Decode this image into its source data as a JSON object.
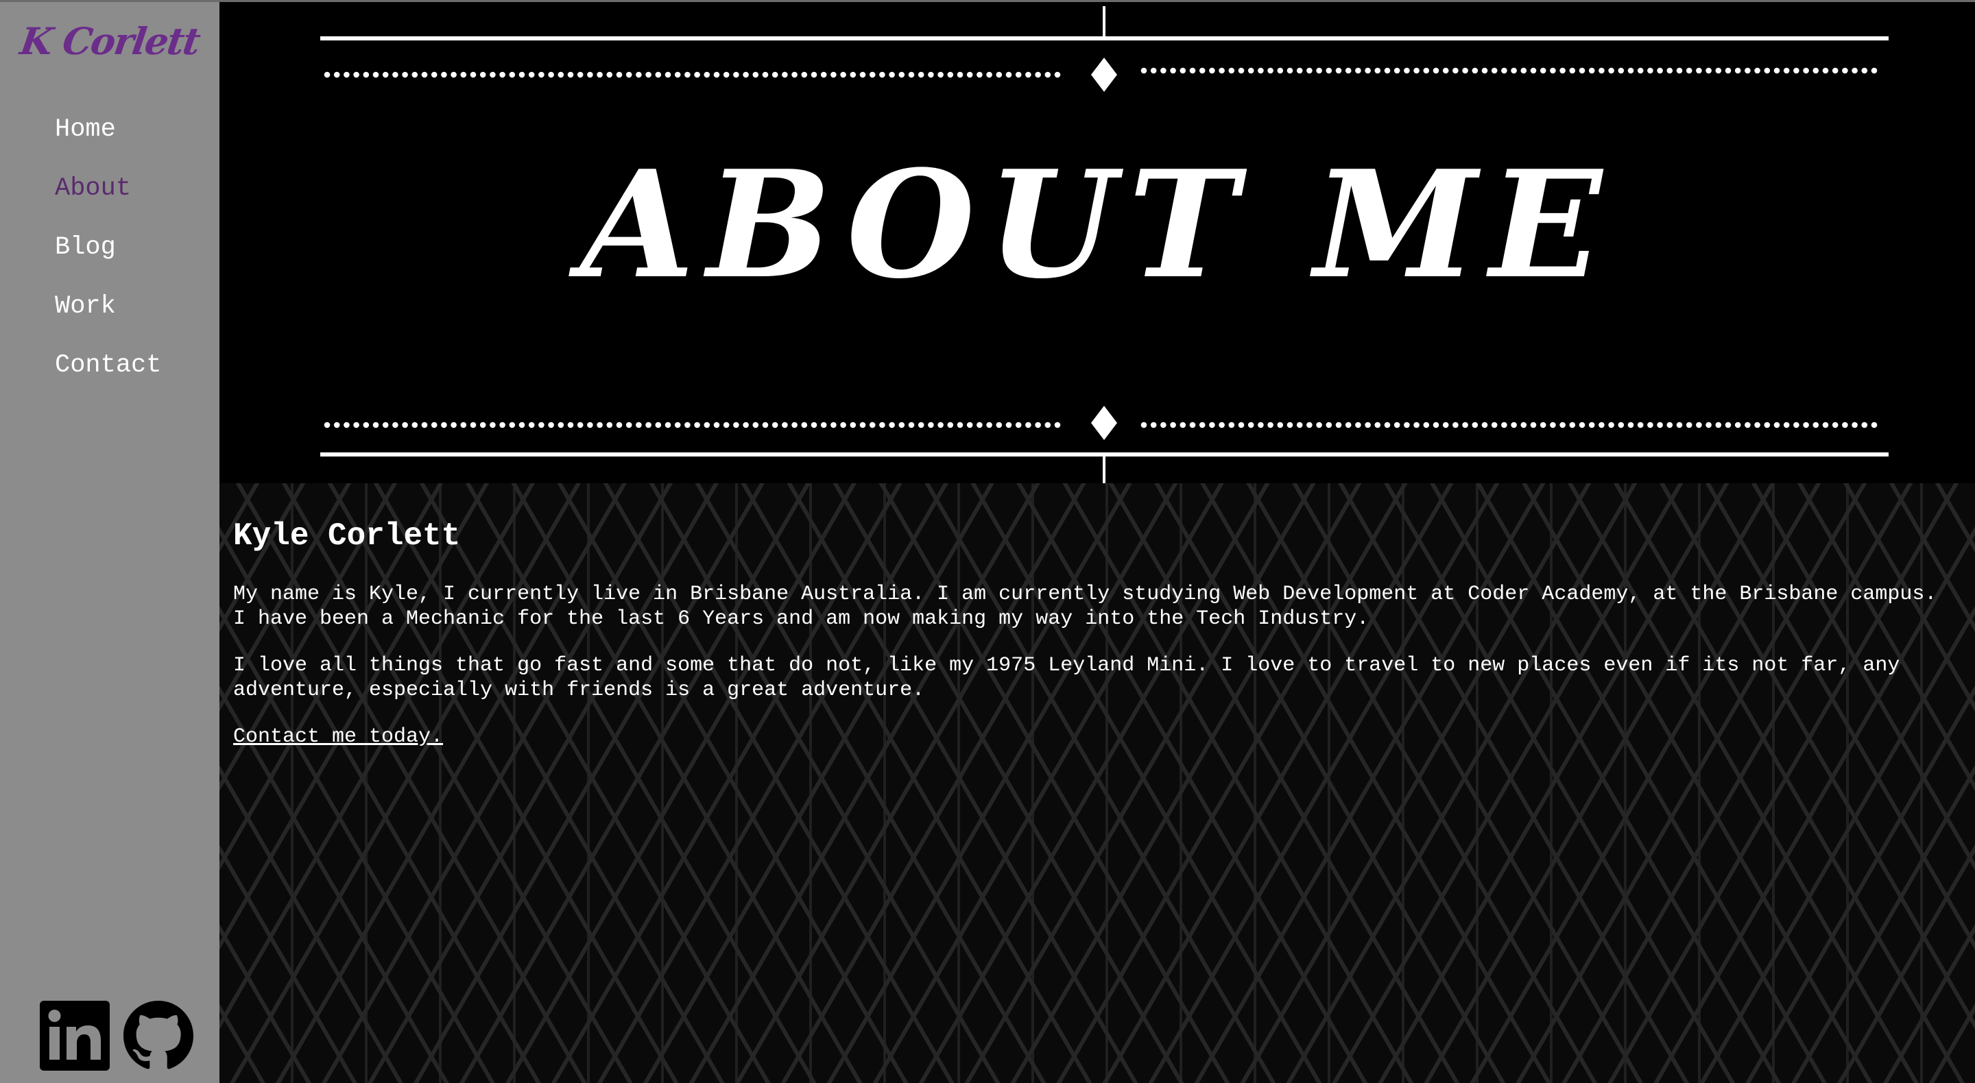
{
  "sidebar": {
    "logo": "K Corlett",
    "nav": [
      {
        "label": "Home"
      },
      {
        "label": "About"
      },
      {
        "label": "Blog"
      },
      {
        "label": "Work"
      },
      {
        "label": "Contact"
      }
    ],
    "active_item": "About",
    "socials": [
      {
        "icon": "linkedin-icon"
      },
      {
        "icon": "github-icon"
      }
    ]
  },
  "banner": {
    "title": "ABOUT ME"
  },
  "content": {
    "name": "Kyle Corlett",
    "paragraph1": "My name is Kyle, I currently live in Brisbane Australia. I am currently studying Web Development at Coder Academy, at the Brisbane campus. I have been a Mechanic for the last 6 Years and am now making my way into the Tech Industry.",
    "paragraph2": "I love all things that go fast and some that do not, like my 1975 Leyland Mini. I love to travel to new places even if its not far, any adventure, especially with friends is a great adventure.",
    "cta": "Contact me today."
  },
  "colors": {
    "sidebar_bg": "#8c8c8c",
    "logo": "#6b2d8a",
    "active_nav": "#5a2a6e",
    "banner_bg": "#000000",
    "text": "#ffffff"
  }
}
